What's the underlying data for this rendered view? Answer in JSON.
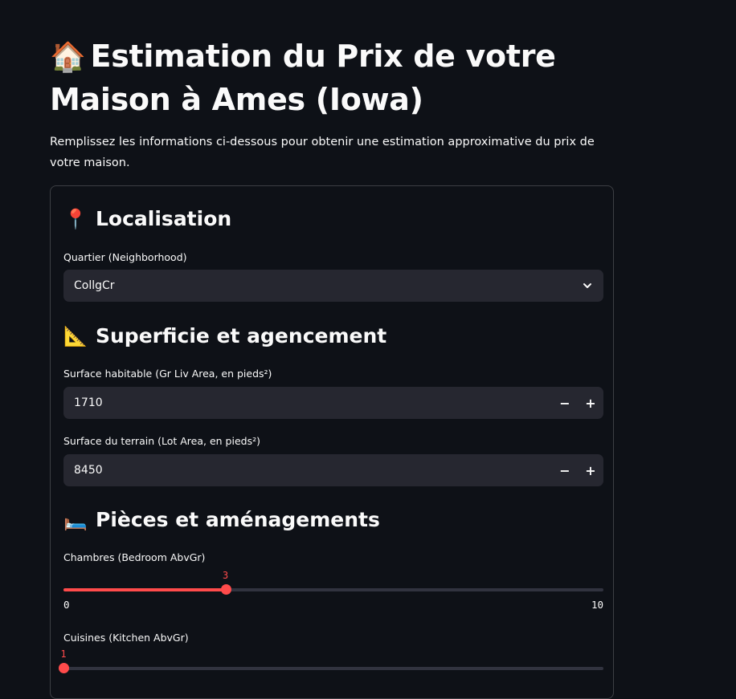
{
  "header": {
    "title_icon": "house-icon",
    "title": "Estimation du Prix de votre Maison à Ames (Iowa)",
    "intro": "Remplissez les informations ci-dessous pour obtenir une estimation approximative du prix de votre maison."
  },
  "sections": {
    "localisation": {
      "icon": "pin-icon",
      "title": "Localisation",
      "neighborhood_label": "Quartier (Neighborhood)",
      "neighborhood_value": "CollgCr"
    },
    "superficie": {
      "icon": "triangle-ruler-icon",
      "title": "Superficie et agencement",
      "gr_liv_area_label": "Surface habitable (Gr Liv Area, en pieds²)",
      "gr_liv_area_value": "1710",
      "lot_area_label": "Surface du terrain (Lot Area, en pieds²)",
      "lot_area_value": "8450",
      "decrement": "−",
      "increment": "+"
    },
    "pieces": {
      "icon": "bed-icon",
      "title": "Pièces et aménagements",
      "bedroom_label": "Chambres (Bedroom AbvGr)",
      "bedroom": {
        "value": 3,
        "min": 0,
        "max": 10,
        "value_text": "3",
        "min_text": "0",
        "max_text": "10"
      },
      "kitchen_label": "Cuisines (Kitchen AbvGr)",
      "kitchen": {
        "value": 1,
        "min": 1,
        "max": 3,
        "value_text": "1"
      }
    }
  },
  "colors": {
    "background": "#0e1117",
    "input_bg": "#262730",
    "accent": "#ff4b4b",
    "text": "#fafafa"
  }
}
